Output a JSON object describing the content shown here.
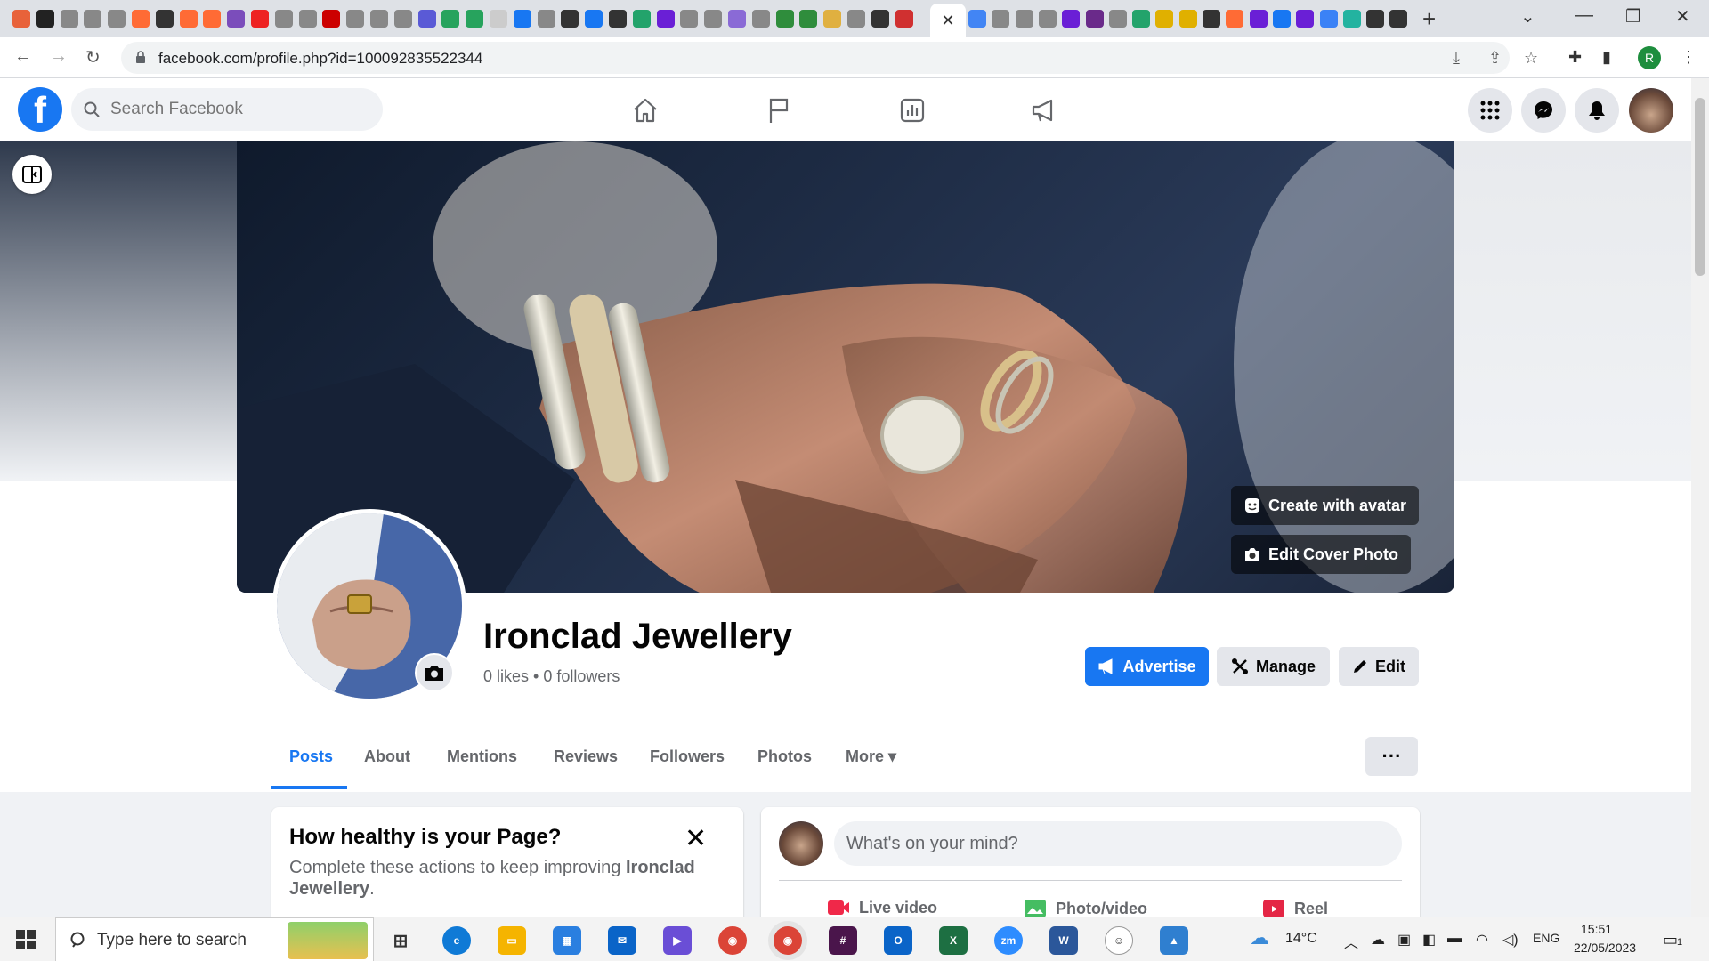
{
  "browser": {
    "favicon_colors": [
      "#e8623a",
      "#222",
      "#888",
      "#888",
      "#888",
      "#ff6b35",
      "#333",
      "#ff6b35",
      "#ff6b35",
      "#7b4dbb",
      "#e22",
      "#888",
      "#888",
      "#c00",
      "#888",
      "#888",
      "#888",
      "#5a5ad6",
      "#27a35d",
      "#27a35d",
      "#ccc",
      "#1877f2",
      "#888",
      "#333",
      "#1877f2",
      "#333",
      "#23a36b",
      "#6a1fd6",
      "#888",
      "#888",
      "#8a6ad6",
      "#888",
      "#2f8d3c",
      "#2f8d3c",
      "#e0b040",
      "#888",
      "#333",
      "#d03030"
    ],
    "active_tab_close": "✕",
    "right_favicon_colors": [
      "#4285f4",
      "#888",
      "#888",
      "#888",
      "#6a1fd6",
      "#6a2a8a",
      "#888",
      "#23a36b",
      "#e0b000",
      "#e0b000",
      "#333",
      "#ff6b35",
      "#6a1fd6",
      "#1877f2",
      "#6a1fd6",
      "#3b82f6",
      "#23b3a0",
      "#333",
      "#333"
    ],
    "new_tab": "+",
    "window_controls": [
      "⌄",
      "—",
      "❐",
      "✕"
    ],
    "url": "facebook.com/profile.php?id=100092835522344",
    "profile_initial": "R"
  },
  "facebook": {
    "logo_letter": "f",
    "search_placeholder": "Search Facebook",
    "nav_icons": [
      "home-icon",
      "flag-icon",
      "insights-icon",
      "megaphone-icon"
    ],
    "right_icons": [
      "apps-grid-icon",
      "messenger-icon",
      "notifications-bell-icon"
    ]
  },
  "cover": {
    "create_avatar_label": "Create with avatar",
    "edit_cover_label": "Edit Cover Photo"
  },
  "profile": {
    "name": "Ironclad Jewellery",
    "stats": "0 likes • 0 followers",
    "advertise_label": "Advertise",
    "manage_label": "Manage",
    "edit_label": "Edit",
    "more_options": "···"
  },
  "tabs": [
    {
      "label": "Posts",
      "active": true
    },
    {
      "label": "About"
    },
    {
      "label": "Mentions"
    },
    {
      "label": "Reviews"
    },
    {
      "label": "Followers"
    },
    {
      "label": "Photos"
    },
    {
      "label": "More ▾"
    }
  ],
  "health_card": {
    "title": "How healthy is your Page?",
    "text_prefix": "Complete these actions to keep improving ",
    "text_bold": "Ironclad Jewellery",
    "text_suffix": "."
  },
  "composer": {
    "placeholder": "What's on your mind?",
    "options": [
      "Live video",
      "Photo/video",
      "Reel"
    ]
  },
  "taskbar": {
    "search_placeholder": "Type here to search",
    "weather": "14°C",
    "language": "ENG",
    "time": "15:51",
    "date": "22/05/2023",
    "notification_count": "1"
  }
}
